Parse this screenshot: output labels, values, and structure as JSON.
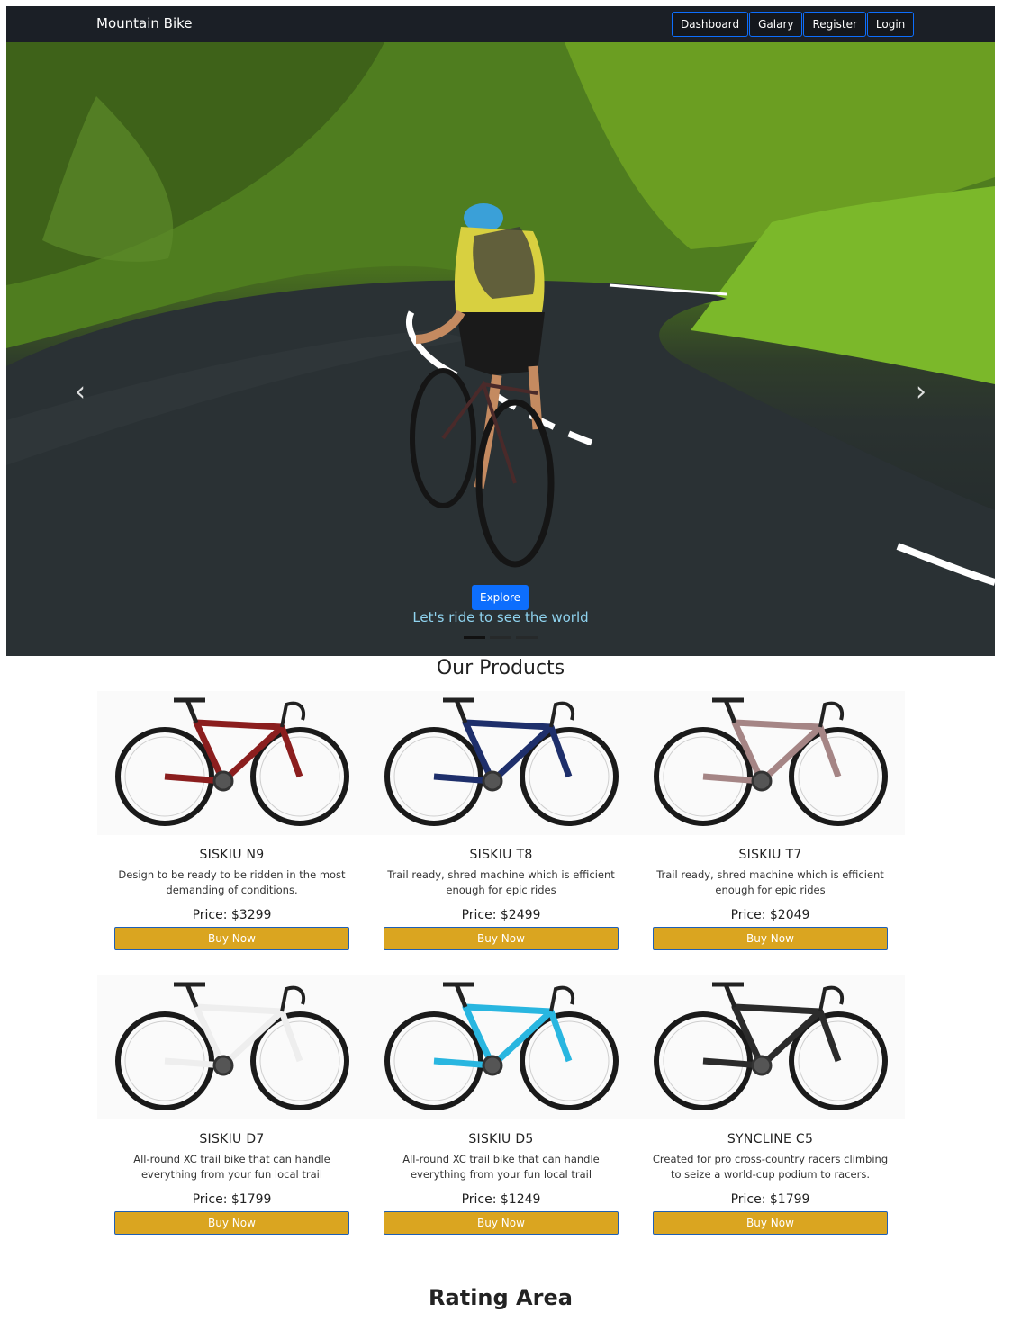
{
  "navbar": {
    "brand": "Mountain Bike",
    "links": [
      "Dashboard",
      "Galary",
      "Register",
      "Login"
    ]
  },
  "hero": {
    "button_label": "Explore",
    "caption": "Let's ride to see the world",
    "prev_icon": "chevron-left-icon",
    "next_icon": "chevron-right-icon",
    "slides_count_indicators": 3,
    "active_slide": 1
  },
  "products_section": {
    "title": "Our Products",
    "products": [
      {
        "name": "SISKIU N9",
        "description": "Design to be ready to be ridden in the most demanding of conditions.",
        "price": "Price: $3299",
        "button": "Buy Now",
        "frame_color": "#8b1e1e"
      },
      {
        "name": "SISKIU T8",
        "description": "Trail ready, shred machine which is efficient enough for epic rides",
        "price": "Price: $2499",
        "button": "Buy Now",
        "frame_color": "#1e2f6b"
      },
      {
        "name": "SISKIU T7",
        "description": "Trail ready, shred machine which is efficient enough for epic rides",
        "price": "Price: $2049",
        "button": "Buy Now",
        "frame_color": "#a58585"
      },
      {
        "name": "SISKIU D7",
        "description": "All-round XC trail bike that can handle everything from your fun local trail",
        "price": "Price: $1799",
        "button": "Buy Now",
        "frame_color": "#eeeeee"
      },
      {
        "name": "SISKIU D5",
        "description": "All-round XC trail bike that can handle everything from your fun local trail",
        "price": "Price: $1249",
        "button": "Buy Now",
        "frame_color": "#29b6e0"
      },
      {
        "name": "SYNCLINE C5",
        "description": "Created for pro cross-country racers climbing to seize a world-cup podium to racers.",
        "price": "Price: $1799",
        "button": "Buy Now",
        "frame_color": "#2b2b2b"
      }
    ]
  },
  "rating_section": {
    "title": "Rating Area"
  },
  "colors": {
    "navbar_bg": "#1b1f26",
    "nav_border": "#0d6efd",
    "explore_btn": "#0d6efd",
    "caption": "#8fd3ef",
    "buy_btn": "#daa520"
  }
}
